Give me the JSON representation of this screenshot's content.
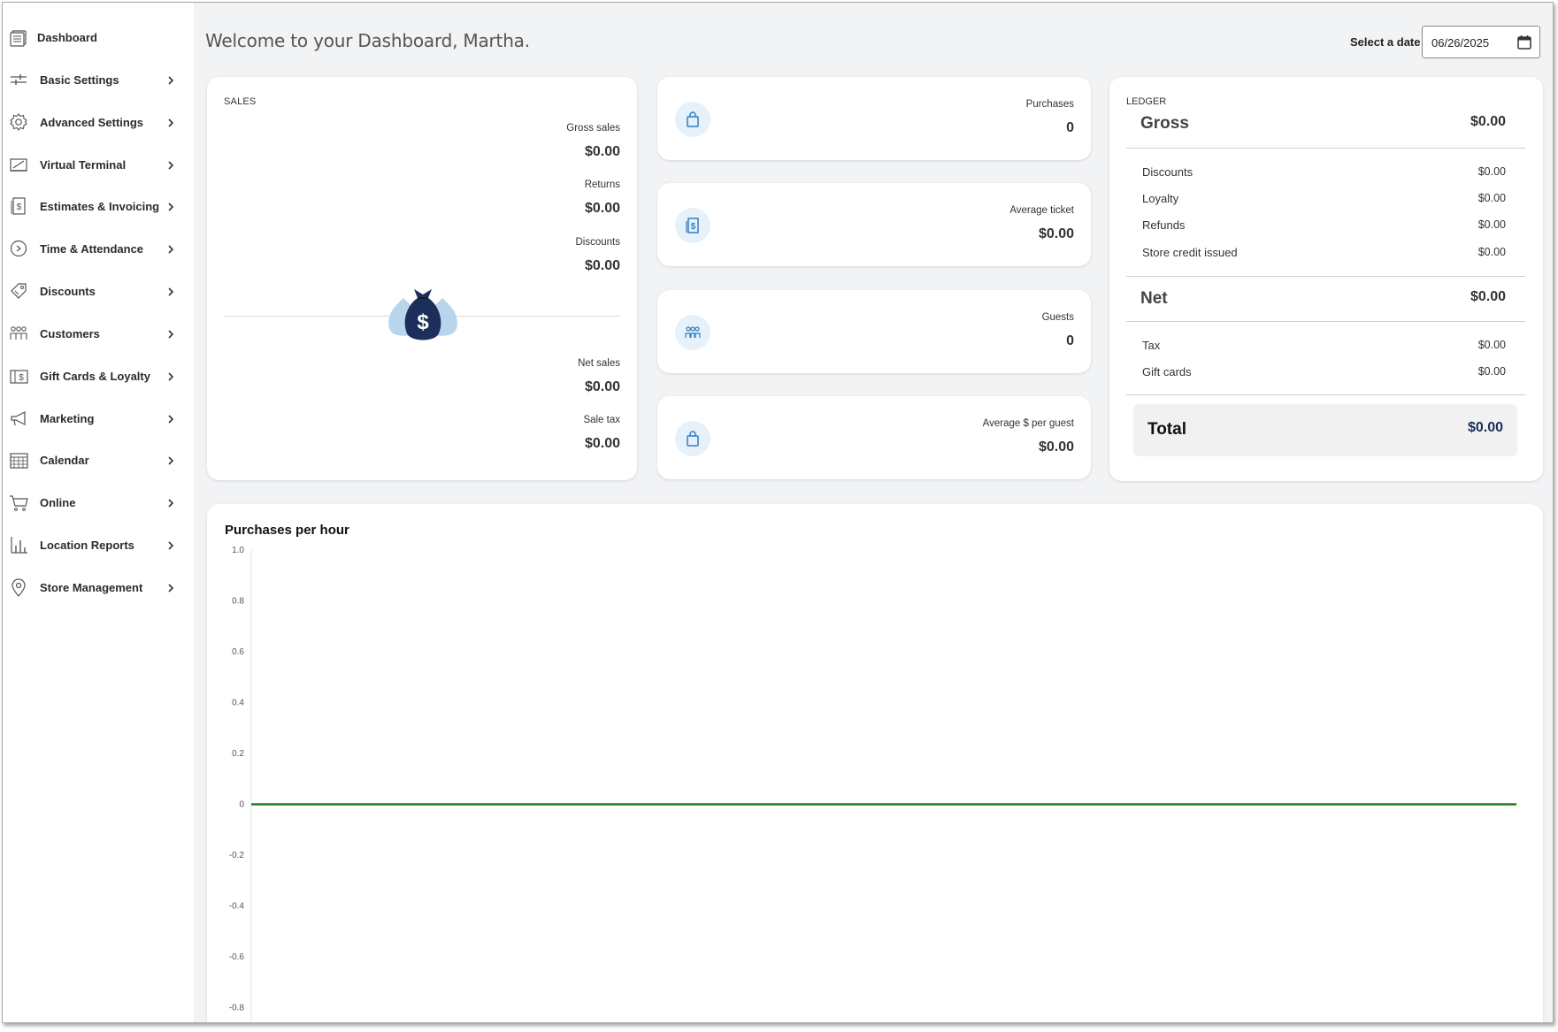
{
  "sidebar": {
    "items": [
      {
        "label": "Dashboard",
        "icon": "dashboard-icon",
        "chevron": false
      },
      {
        "label": "Basic Settings",
        "icon": "sliders-icon",
        "chevron": true
      },
      {
        "label": "Advanced Settings",
        "icon": "gear-icon",
        "chevron": true
      },
      {
        "label": "Virtual Terminal",
        "icon": "terminal-icon",
        "chevron": true
      },
      {
        "label": "Estimates & Invoicing",
        "icon": "invoice-icon",
        "chevron": true
      },
      {
        "label": "Time & Attendance",
        "icon": "clock-icon",
        "chevron": true
      },
      {
        "label": "Discounts",
        "icon": "tag-icon",
        "chevron": true
      },
      {
        "label": "Customers",
        "icon": "customers-icon",
        "chevron": true
      },
      {
        "label": "Gift Cards & Loyalty",
        "icon": "gift-card-icon",
        "chevron": true
      },
      {
        "label": "Marketing",
        "icon": "megaphone-icon",
        "chevron": true
      },
      {
        "label": "Calendar",
        "icon": "calendar-icon",
        "chevron": true
      },
      {
        "label": "Online",
        "icon": "cart-icon",
        "chevron": true
      },
      {
        "label": "Location Reports",
        "icon": "bar-chart-icon",
        "chevron": true
      },
      {
        "label": "Store Management",
        "icon": "location-pin-icon",
        "chevron": true
      }
    ]
  },
  "header": {
    "welcome": "Welcome to your Dashboard, Martha.",
    "date_label": "Select a date",
    "date_value": "06/26/2025"
  },
  "sales": {
    "title": "SALES",
    "gross_sales_label": "Gross sales",
    "gross_sales_value": "$0.00",
    "returns_label": "Returns",
    "returns_value": "$0.00",
    "discounts_label": "Discounts",
    "discounts_value": "$0.00",
    "net_sales_label": "Net sales",
    "net_sales_value": "$0.00",
    "sale_tax_label": "Sale tax",
    "sale_tax_value": "$0.00"
  },
  "metrics": {
    "purchases": {
      "label": "Purchases",
      "value": "0"
    },
    "average_ticket": {
      "label": "Average ticket",
      "value": "$0.00"
    },
    "guests": {
      "label": "Guests",
      "value": "0"
    },
    "avg_per_guest": {
      "label": "Average $ per guest",
      "value": "$0.00"
    }
  },
  "ledger": {
    "title": "LEDGER",
    "gross_label": "Gross",
    "gross_value": "$0.00",
    "discounts_label": "Discounts",
    "discounts_value": "$0.00",
    "loyalty_label": "Loyalty",
    "loyalty_value": "$0.00",
    "refunds_label": "Refunds",
    "refunds_value": "$0.00",
    "store_credit_label": "Store credit issued",
    "store_credit_value": "$0.00",
    "net_label": "Net",
    "net_value": "$0.00",
    "tax_label": "Tax",
    "tax_value": "$0.00",
    "gift_cards_label": "Gift cards",
    "gift_cards_value": "$0.00",
    "total_label": "Total",
    "total_value": "$0.00"
  },
  "colors": {
    "accent_blue": "#2d7fc1",
    "icon_bg": "#e6f1fa",
    "navy": "#1b2f5a",
    "line_green": "#1a7f1a"
  },
  "chart_data": {
    "type": "line",
    "title": "Purchases per hour",
    "ylim": [
      -0.8,
      1.0
    ],
    "yticks": [
      "1.0",
      "0.8",
      "0.6",
      "0.4",
      "0.2",
      "0",
      "-0.2",
      "-0.4",
      "-0.6",
      "-0.8"
    ],
    "series": [
      {
        "values": [
          0,
          0,
          0,
          0,
          0,
          0,
          0,
          0,
          0,
          0,
          0,
          0,
          0,
          0,
          0,
          0,
          0,
          0,
          0,
          0,
          0,
          0,
          0,
          0
        ]
      }
    ]
  }
}
